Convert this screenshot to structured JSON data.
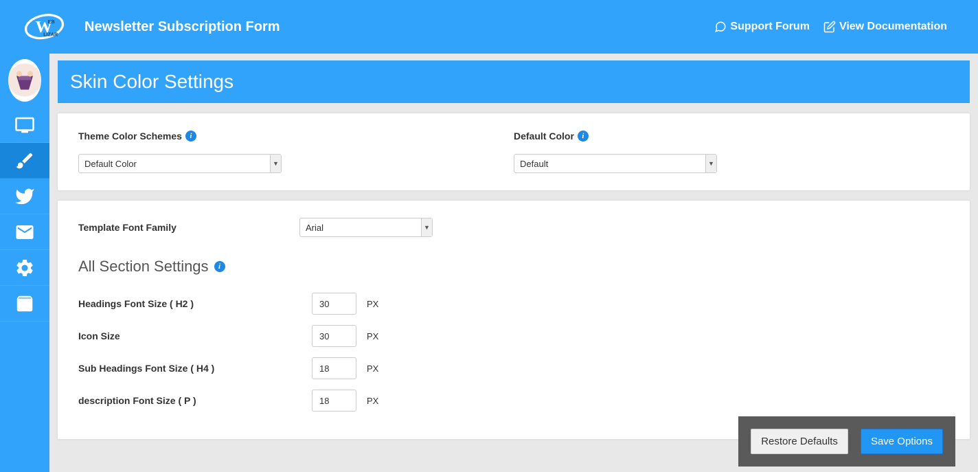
{
  "header": {
    "title": "Newsletter Subscription Form",
    "support_forum": "Support Forum",
    "view_docs": "View Documentation"
  },
  "page": {
    "title": "Skin Color Settings"
  },
  "panel1": {
    "theme_color_label": "Theme Color Schemes",
    "theme_color_value": "Default Color",
    "default_color_label": "Default Color",
    "default_color_value": "Default"
  },
  "panel2": {
    "template_font_label": "Template Font Family",
    "template_font_value": "Arial",
    "section_heading": "All Section Settings",
    "h2_label": "Headings Font Size ( H2 )",
    "h2_value": "30",
    "icon_label": "Icon Size",
    "icon_value": "30",
    "h4_label": "Sub Headings Font Size ( H4 )",
    "h4_value": "18",
    "p_label": "description Font Size ( P )",
    "p_value": "18",
    "px": "PX"
  },
  "footer": {
    "restore": "Restore Defaults",
    "save": "Save Options"
  }
}
